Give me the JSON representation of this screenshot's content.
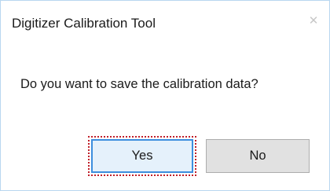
{
  "dialog": {
    "title": "Digitizer Calibration Tool",
    "close_icon": "close-icon",
    "message": "Do you want to save the calibration data?",
    "buttons": {
      "yes_label": "Yes",
      "no_label": "No",
      "focused": "Yes"
    }
  },
  "colors": {
    "focused_button_border": "#3c8ede",
    "focused_button_bg": "#e5f1fb",
    "focus_ring": "#c0202a",
    "button_bg": "#e1e1e1",
    "window_border": "#b9d7f0"
  }
}
